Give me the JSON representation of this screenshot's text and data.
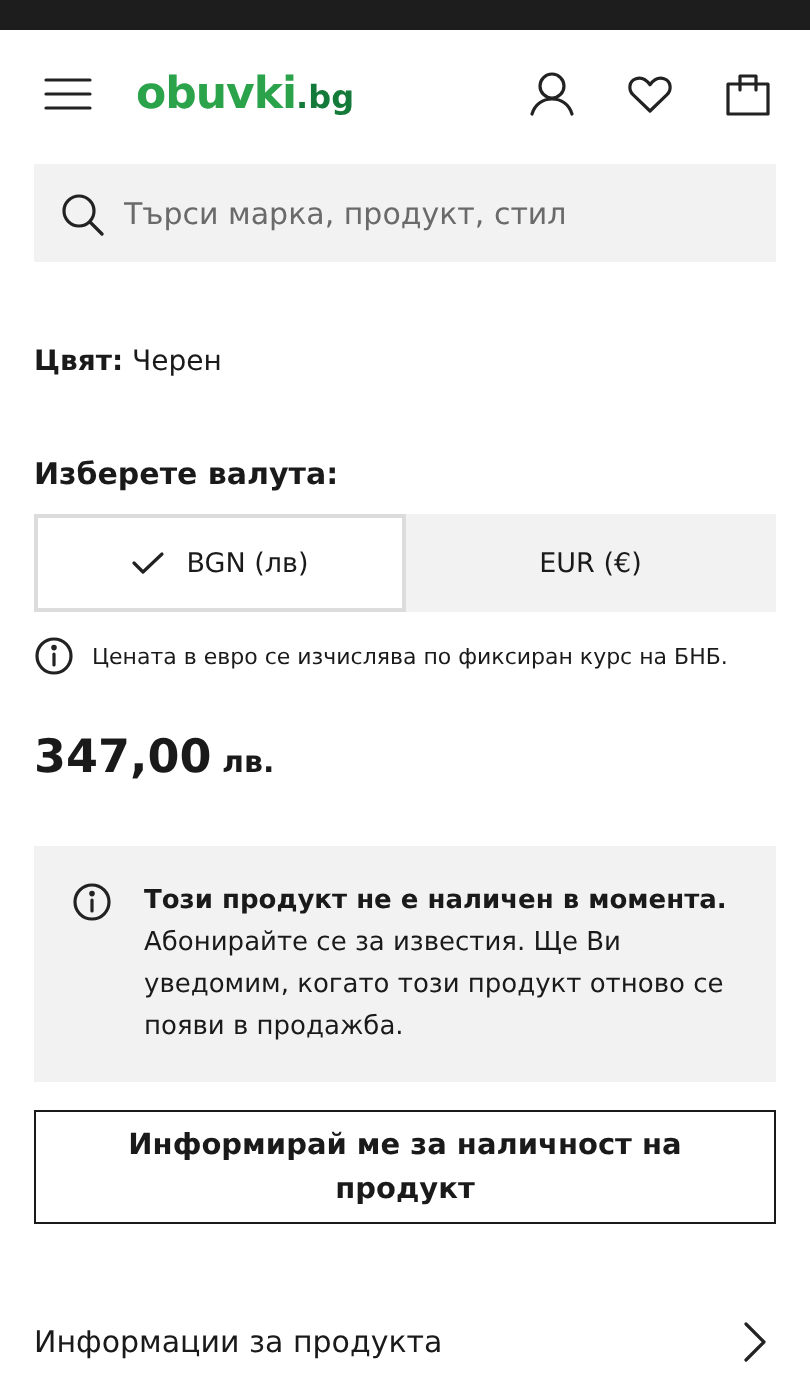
{
  "header": {
    "logo": {
      "name": "obuvki",
      "suffix": ".bg"
    }
  },
  "search": {
    "placeholder": "Търси марка, продукт, стил"
  },
  "color_line": "**Цвят:** Черен",
  "currency": {
    "label": "Изберете валута:",
    "options": [
      {
        "label": "BGN (лв)",
        "selected": true
      },
      {
        "label": "EUR (€)",
        "selected": false
      }
    ],
    "note": "Цената в евро се изчислява по фиксиран курс на БНБ."
  },
  "price": {
    "amount": "347,00",
    "currency": "лв."
  },
  "notice": "**Този продукт не е наличен в момента.** Абонирайте се за известия. Ще Ви уведомим, когато този продукт отново се появи в продажба.",
  "notify_button": "Информирай ме за наличност на продукт",
  "sections": [
    {
      "label": "Информации за продукта"
    }
  ]
}
